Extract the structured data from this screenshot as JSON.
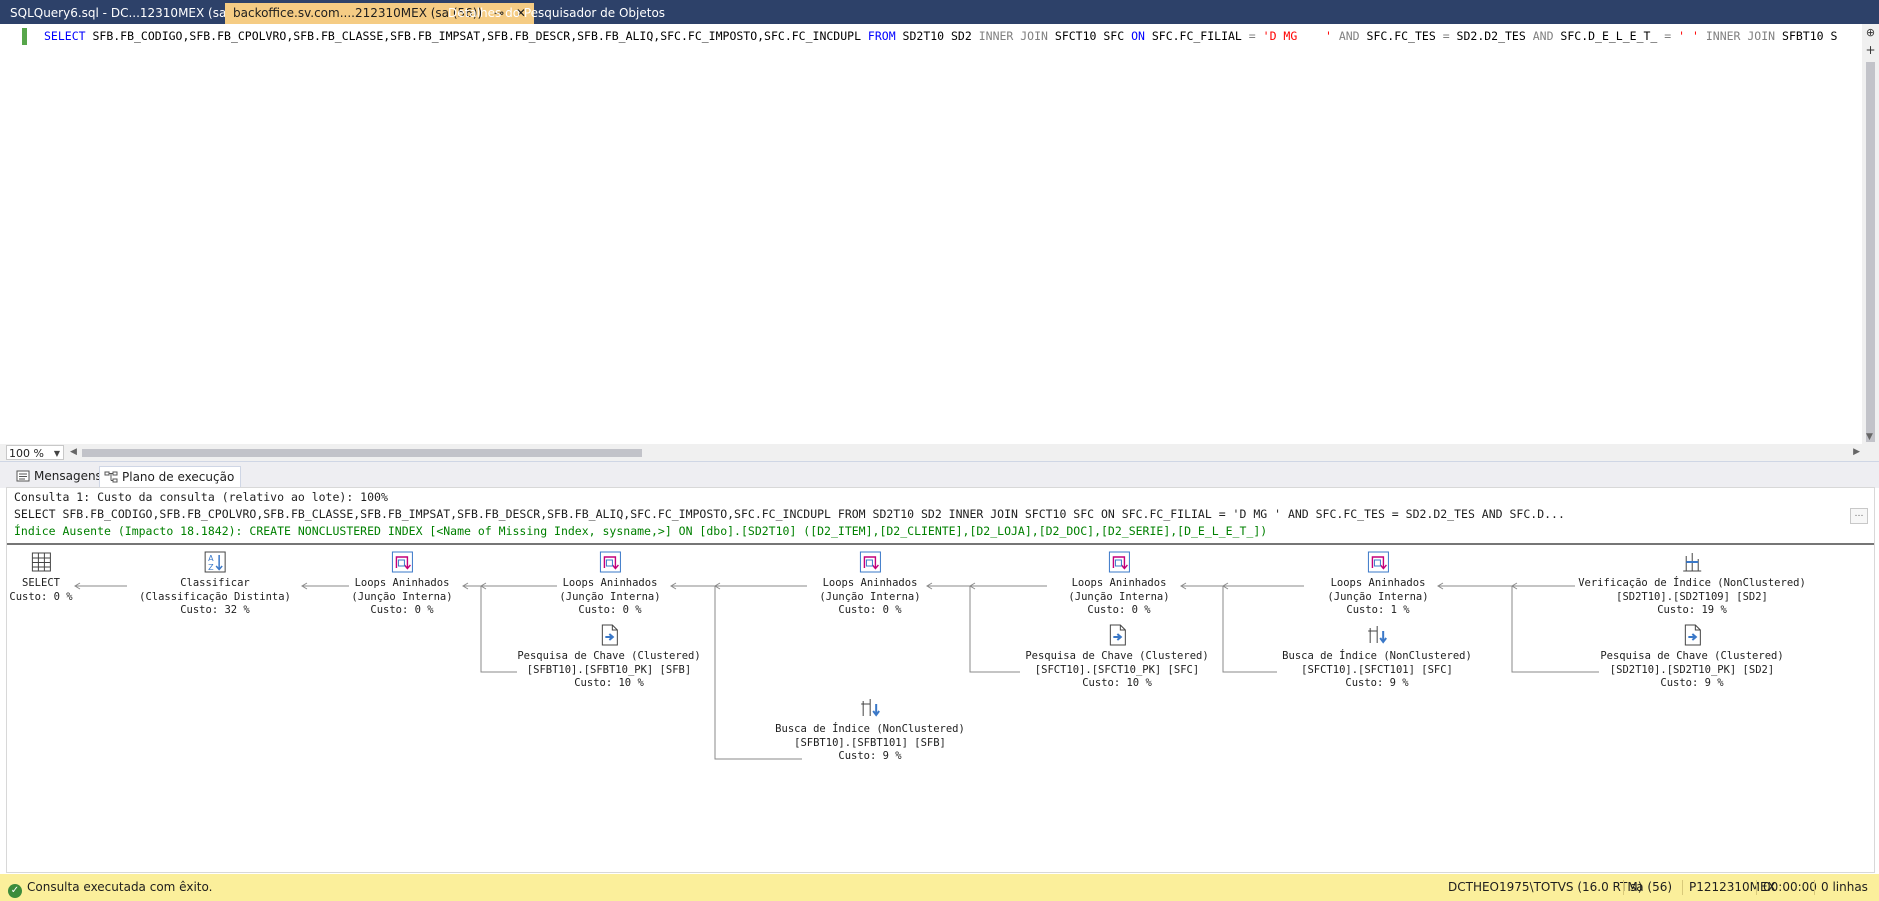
{
  "tabs": [
    {
      "label": "SQLQuery6.sql - DC...12310MEX (sa (65))*",
      "active": false
    },
    {
      "label": "backoffice.sv.com....212310MEX (sa (56))",
      "active": true,
      "pin": "⊸",
      "close": "✕"
    },
    {
      "label": "Detalhes do Pesquisador de Objetos",
      "active": false
    }
  ],
  "editor": {
    "tokens": [
      {
        "t": "SELECT ",
        "c": "kw"
      },
      {
        "t": "SFB.FB_CODIGO,SFB.FB_CPOLVRO,SFB.FB_CLASSE,SFB.FB_IMPSAT,SFB.FB_DESCR,SFB.FB_ALIQ,SFC.FC_IMPOSTO,SFC.FC_INCDUPL ",
        "c": "id"
      },
      {
        "t": "FROM ",
        "c": "kw"
      },
      {
        "t": "SD2T10 SD2 ",
        "c": "id"
      },
      {
        "t": "INNER JOIN ",
        "c": "gray"
      },
      {
        "t": "SFCT10 SFC ",
        "c": "id"
      },
      {
        "t": "ON ",
        "c": "kw"
      },
      {
        "t": "SFC.FC_FILIAL ",
        "c": "id"
      },
      {
        "t": "= ",
        "c": "gray"
      },
      {
        "t": "'D MG    ' ",
        "c": "str"
      },
      {
        "t": "AND ",
        "c": "gray"
      },
      {
        "t": "SFC.FC_TES ",
        "c": "id"
      },
      {
        "t": "= ",
        "c": "gray"
      },
      {
        "t": "SD2.D2_TES ",
        "c": "id"
      },
      {
        "t": "AND ",
        "c": "gray"
      },
      {
        "t": "SFC.D_E_L_E_T_ ",
        "c": "id"
      },
      {
        "t": "= ",
        "c": "gray"
      },
      {
        "t": "' ' ",
        "c": "str"
      },
      {
        "t": "INNER JOIN ",
        "c": "gray"
      },
      {
        "t": "SFBT10 S",
        "c": "id"
      }
    ],
    "split_icon": "⊕",
    "add_icon": "+"
  },
  "zoom": {
    "value": "100 %"
  },
  "result_tabs": [
    {
      "label": "Mensagens",
      "icon": "messages-icon",
      "selected": false
    },
    {
      "label": "Plano de execução",
      "icon": "execution-plan-icon",
      "selected": true
    }
  ],
  "plan": {
    "header1": "Consulta 1: Custo da consulta (relativo ao lote): 100%",
    "header2": "SELECT SFB.FB_CODIGO,SFB.FB_CPOLVRO,SFB.FB_CLASSE,SFB.FB_IMPSAT,SFB.FB_DESCR,SFB.FB_ALIQ,SFC.FC_IMPOSTO,SFC.FC_INCDUPL FROM SD2T10 SD2 INNER JOIN SFCT10 SFC ON SFC.FC_FILIAL = 'D MG ' AND SFC.FC_TES = SD2.D2_TES AND SFC.D...",
    "missing_index": "Índice Ausente (Impacto 18.1842): CREATE NONCLUSTERED INDEX [<Name of Missing Index, sysname,>] ON [dbo].[SD2T10] ([D2_ITEM],[D2_CLIENTE],[D2_LOJA],[D2_DOC],[D2_SERIE],[D_E_L_E_T_])",
    "more": "…",
    "nodes": [
      {
        "id": "select",
        "icon": "select-icon",
        "lines": [
          "SELECT",
          "Custo: 0 %"
        ]
      },
      {
        "id": "sort",
        "icon": "sort-icon",
        "lines": [
          "Classificar",
          "(Classificação Distinta)",
          "Custo: 32 %"
        ]
      },
      {
        "id": "loop1",
        "icon": "nested-loops-icon",
        "lines": [
          "Loops Aninhados",
          "(Junção Interna)",
          "Custo: 0 %"
        ]
      },
      {
        "id": "loop2",
        "icon": "nested-loops-icon",
        "lines": [
          "Loops Aninhados",
          "(Junção Interna)",
          "Custo: 0 %"
        ]
      },
      {
        "id": "loop3",
        "icon": "nested-loops-icon",
        "lines": [
          "Loops Aninhados",
          "(Junção Interna)",
          "Custo: 0 %"
        ]
      },
      {
        "id": "loop4",
        "icon": "nested-loops-icon",
        "lines": [
          "Loops Aninhados",
          "(Junção Interna)",
          "Custo: 0 %"
        ]
      },
      {
        "id": "loop5",
        "icon": "nested-loops-icon",
        "lines": [
          "Loops Aninhados",
          "(Junção Interna)",
          "Custo: 1 %"
        ]
      },
      {
        "id": "scan",
        "icon": "index-scan-icon",
        "lines": [
          "Verificação de Índice (NonClustered)",
          "[SD2T10].[SD2T109] [SD2]",
          "Custo: 19 %"
        ]
      },
      {
        "id": "lookup1",
        "icon": "key-lookup-icon",
        "lines": [
          "Pesquisa de Chave (Clustered)",
          "[SFBT10].[SFBT10_PK] [SFB]",
          "Custo: 10 %"
        ]
      },
      {
        "id": "lookup2",
        "icon": "key-lookup-icon",
        "lines": [
          "Pesquisa de Chave (Clustered)",
          "[SFCT10].[SFCT10_PK] [SFC]",
          "Custo: 10 %"
        ]
      },
      {
        "id": "seek1",
        "icon": "index-seek-icon",
        "lines": [
          "Busca de Índice (NonClustered)",
          "[SFCT10].[SFCT101] [SFC]",
          "Custo: 9 %"
        ]
      },
      {
        "id": "lookup3",
        "icon": "key-lookup-icon",
        "lines": [
          "Pesquisa de Chave (Clustered)",
          "[SD2T10].[SD2T10_PK] [SD2]",
          "Custo: 9 %"
        ]
      },
      {
        "id": "seek2",
        "icon": "index-seek-icon",
        "lines": [
          "Busca de Índice (NonClustered)",
          "[SFBT10].[SFBT101] [SFB]",
          "Custo: 9 %"
        ]
      }
    ]
  },
  "status": {
    "message": "Consulta executada com êxito.",
    "icon": "check-icon",
    "server": "DCTHEO1975\\TOTVS (16.0 RTM)",
    "user": "sa (56)",
    "database": "P1212310MEX",
    "elapsed": "00:00:00",
    "rows": "0 linhas"
  },
  "colors": {
    "tabbar": "#2d4169",
    "active_tab": "#f5cc84",
    "statusbar": "#fbef9b",
    "keyword": "#0000ff",
    "string": "#ff0000",
    "missing_index": "#008000",
    "plan_icon": "#3a78c8",
    "plan_icon_accent": "#c4007a"
  }
}
